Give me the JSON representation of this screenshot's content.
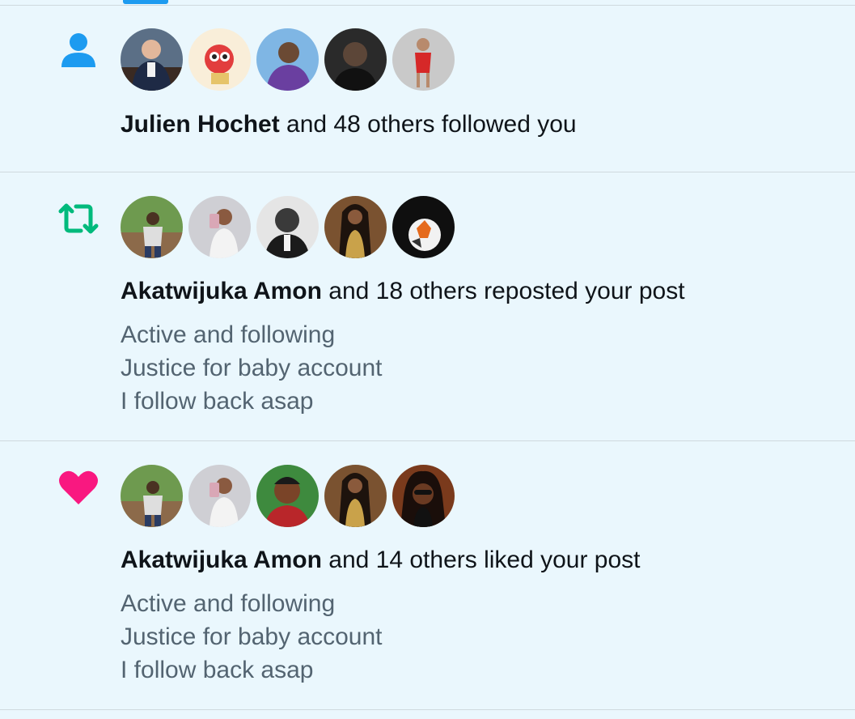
{
  "notifications": [
    {
      "kind": "follow",
      "icon": "person-icon",
      "icon_color": "#1d9bf0",
      "actor": "Julien Hochet",
      "text": " and 48 others followed you",
      "snippet": []
    },
    {
      "kind": "repost",
      "icon": "repost-icon",
      "icon_color": "#00ba7c",
      "actor": "Akatwijuka Amon",
      "text": " and 18 others reposted your post",
      "snippet": [
        "Active and following",
        "Justice for baby account",
        "I follow back asap"
      ]
    },
    {
      "kind": "like",
      "icon": "heart-icon",
      "icon_color": "#f91880",
      "actor": "Akatwijuka Amon",
      "text": " and 14 others liked your post",
      "snippet": [
        "Active and following",
        "Justice for baby account",
        "I follow back asap"
      ]
    }
  ]
}
